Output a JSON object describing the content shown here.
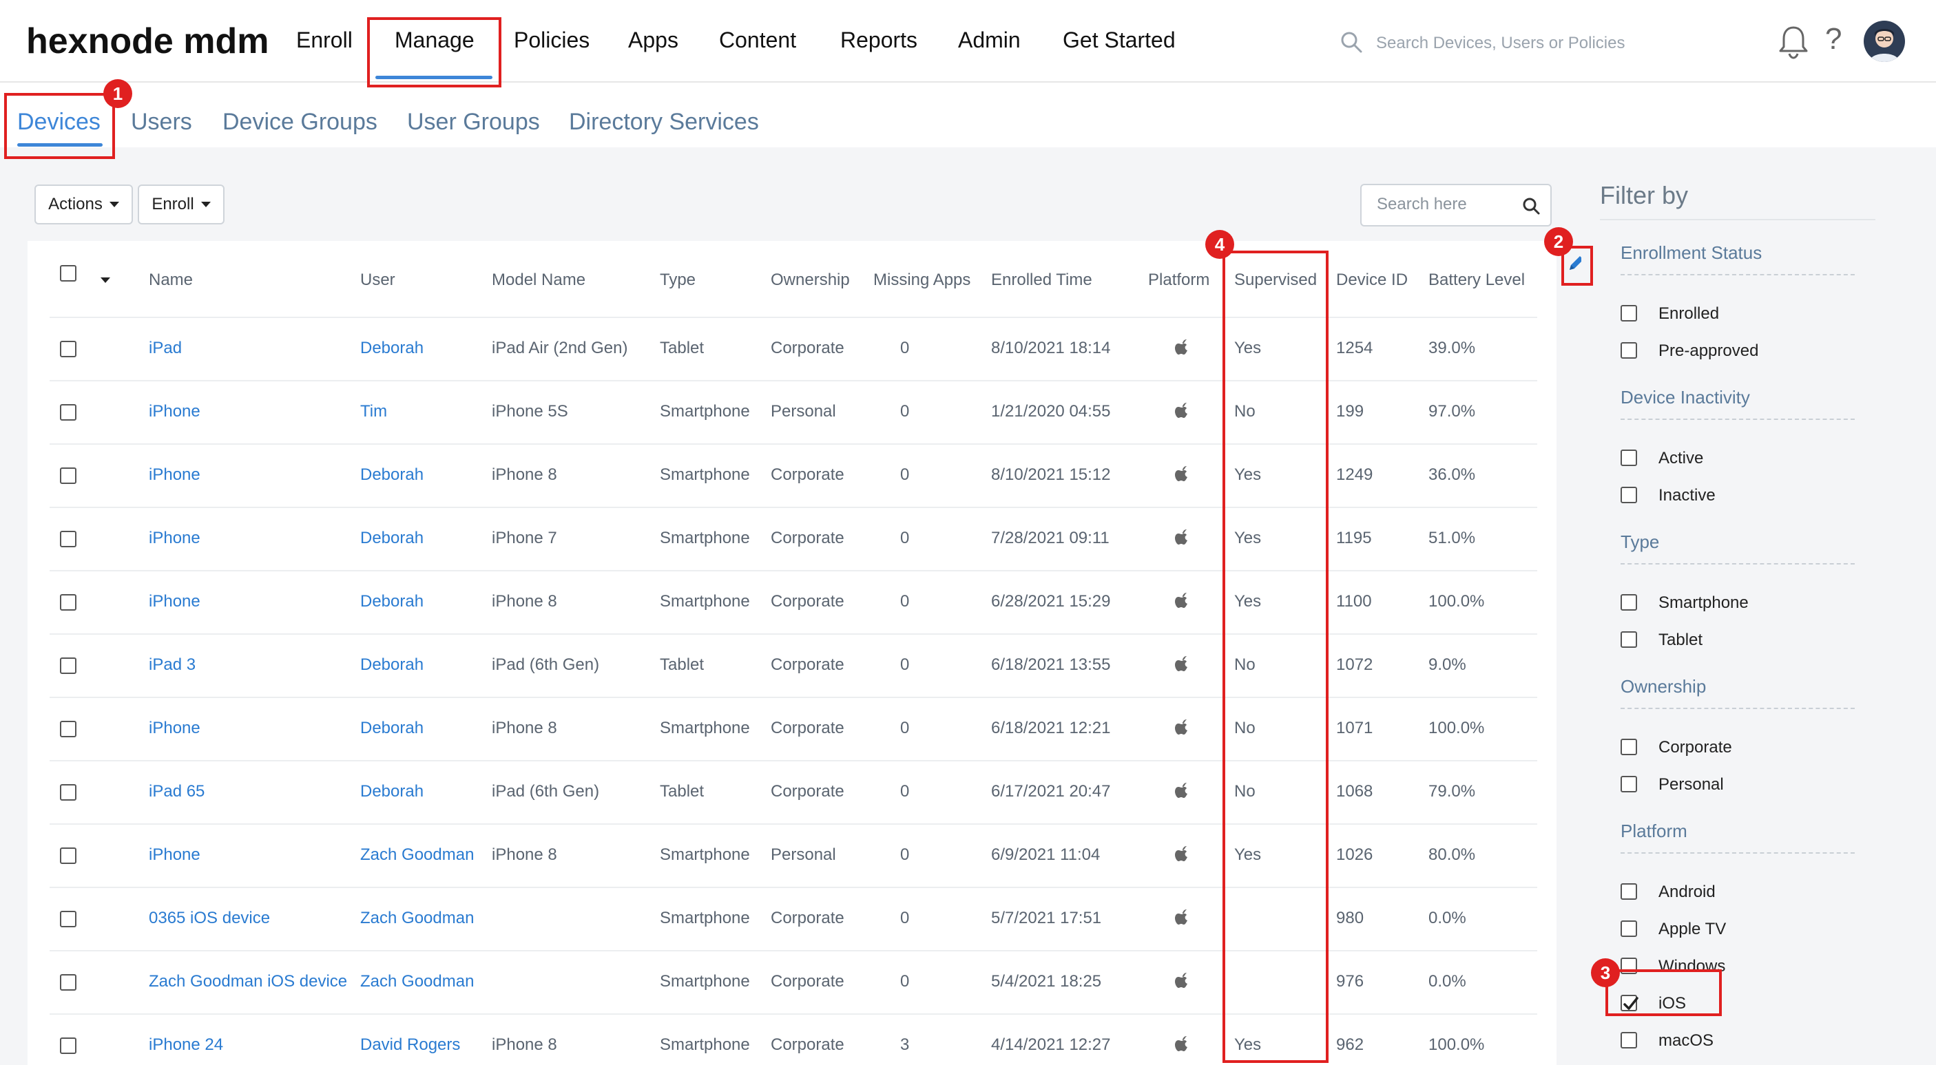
{
  "app": {
    "logo": "hexnode mdm"
  },
  "topnav": {
    "items": [
      "Enroll",
      "Manage",
      "Policies",
      "Apps",
      "Content",
      "Reports",
      "Admin",
      "Get Started"
    ],
    "active": "Manage",
    "search_placeholder": "Search Devices, Users or Policies"
  },
  "subtabs": {
    "items": [
      "Devices",
      "Users",
      "Device Groups",
      "User Groups",
      "Directory Services"
    ],
    "active": "Devices"
  },
  "toolbar": {
    "actions_label": "Actions",
    "enroll_label": "Enroll",
    "search_placeholder": "Search here"
  },
  "table": {
    "columns": [
      "Name",
      "User",
      "Model Name",
      "Type",
      "Ownership",
      "Missing Apps",
      "Enrolled Time",
      "Platform",
      "Supervised",
      "Device ID",
      "Battery Level"
    ],
    "rows": [
      {
        "name": "iPad",
        "user": "Deborah",
        "model": "iPad Air (2nd Gen)",
        "type": "Tablet",
        "ownership": "Corporate",
        "missing": "0",
        "enrolled": "8/10/2021 18:14",
        "platform": "apple-icon",
        "supervised": "Yes",
        "device_id": "1254",
        "battery": "39.0%"
      },
      {
        "name": "iPhone",
        "user": "Tim",
        "model": "iPhone 5S",
        "type": "Smartphone",
        "ownership": "Personal",
        "missing": "0",
        "enrolled": "1/21/2020 04:55",
        "platform": "apple-icon",
        "supervised": "No",
        "device_id": "199",
        "battery": "97.0%"
      },
      {
        "name": "iPhone",
        "user": "Deborah",
        "model": "iPhone 8",
        "type": "Smartphone",
        "ownership": "Corporate",
        "missing": "0",
        "enrolled": "8/10/2021 15:12",
        "platform": "apple-icon",
        "supervised": "Yes",
        "device_id": "1249",
        "battery": "36.0%"
      },
      {
        "name": "iPhone",
        "user": "Deborah",
        "model": "iPhone 7",
        "type": "Smartphone",
        "ownership": "Corporate",
        "missing": "0",
        "enrolled": "7/28/2021 09:11",
        "platform": "apple-icon",
        "supervised": "Yes",
        "device_id": "1195",
        "battery": "51.0%"
      },
      {
        "name": "iPhone",
        "user": "Deborah",
        "model": "iPhone 8",
        "type": "Smartphone",
        "ownership": "Corporate",
        "missing": "0",
        "enrolled": "6/28/2021 15:29",
        "platform": "apple-icon",
        "supervised": "Yes",
        "device_id": "1100",
        "battery": "100.0%"
      },
      {
        "name": "iPad 3",
        "user": "Deborah",
        "model": "iPad (6th Gen)",
        "type": "Tablet",
        "ownership": "Corporate",
        "missing": "0",
        "enrolled": "6/18/2021 13:55",
        "platform": "apple-icon",
        "supervised": "No",
        "device_id": "1072",
        "battery": "9.0%"
      },
      {
        "name": "iPhone",
        "user": "Deborah",
        "model": "iPhone 8",
        "type": "Smartphone",
        "ownership": "Corporate",
        "missing": "0",
        "enrolled": "6/18/2021 12:21",
        "platform": "apple-icon",
        "supervised": "No",
        "device_id": "1071",
        "battery": "100.0%"
      },
      {
        "name": "iPad 65",
        "user": "Deborah",
        "model": "iPad (6th Gen)",
        "type": "Tablet",
        "ownership": "Corporate",
        "missing": "0",
        "enrolled": "6/17/2021 20:47",
        "platform": "apple-icon",
        "supervised": "No",
        "device_id": "1068",
        "battery": "79.0%"
      },
      {
        "name": "iPhone",
        "user": "Zach Goodman",
        "model": "iPhone 8",
        "type": "Smartphone",
        "ownership": "Personal",
        "missing": "0",
        "enrolled": "6/9/2021 11:04",
        "platform": "apple-icon",
        "supervised": "Yes",
        "device_id": "1026",
        "battery": "80.0%"
      },
      {
        "name": "0365 iOS device",
        "user": "Zach Goodman",
        "model": "",
        "type": "Smartphone",
        "ownership": "Corporate",
        "missing": "0",
        "enrolled": "5/7/2021 17:51",
        "platform": "apple-icon",
        "supervised": "",
        "device_id": "980",
        "battery": "0.0%"
      },
      {
        "name": "Zach Goodman iOS device",
        "user": "Zach Goodman",
        "model": "",
        "type": "Smartphone",
        "ownership": "Corporate",
        "missing": "0",
        "enrolled": "5/4/2021 18:25",
        "platform": "apple-icon",
        "supervised": "",
        "device_id": "976",
        "battery": "0.0%"
      },
      {
        "name": "iPhone 24",
        "user": "David Rogers",
        "model": "iPhone 8",
        "type": "Smartphone",
        "ownership": "Corporate",
        "missing": "3",
        "enrolled": "4/14/2021 12:27",
        "platform": "apple-icon",
        "supervised": "Yes",
        "device_id": "962",
        "battery": "100.0%"
      }
    ]
  },
  "filter": {
    "title": "Filter by",
    "sections": [
      {
        "name": "Enrollment Status",
        "options": [
          {
            "label": "Enrolled",
            "checked": false
          },
          {
            "label": "Pre-approved",
            "checked": false
          }
        ]
      },
      {
        "name": "Device Inactivity",
        "options": [
          {
            "label": "Active",
            "checked": false
          },
          {
            "label": "Inactive",
            "checked": false
          }
        ]
      },
      {
        "name": "Type",
        "options": [
          {
            "label": "Smartphone",
            "checked": false
          },
          {
            "label": "Tablet",
            "checked": false
          }
        ]
      },
      {
        "name": "Ownership",
        "options": [
          {
            "label": "Corporate",
            "checked": false
          },
          {
            "label": "Personal",
            "checked": false
          }
        ]
      },
      {
        "name": "Platform",
        "options": [
          {
            "label": "Android",
            "checked": false
          },
          {
            "label": "Apple TV",
            "checked": false
          },
          {
            "label": "Windows",
            "checked": false
          },
          {
            "label": "iOS",
            "checked": true
          },
          {
            "label": "macOS",
            "checked": false
          }
        ]
      }
    ]
  },
  "annotations": [
    "1",
    "2",
    "3",
    "4"
  ],
  "colors": {
    "accent": "#3d86d8",
    "link": "#2a7bd1",
    "annotation": "#e02020"
  }
}
